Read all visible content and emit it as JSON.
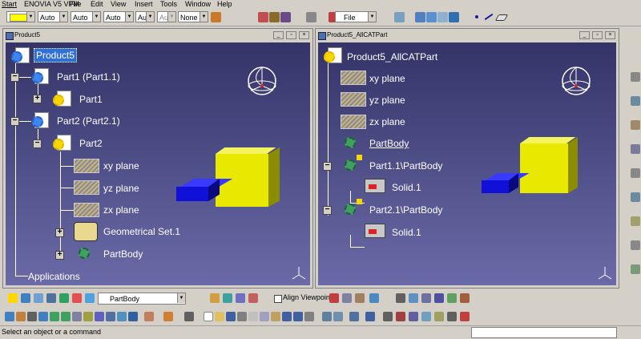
{
  "menu": [
    "Start",
    "ENOVIA V5 VPM",
    "File",
    "Edit",
    "View",
    "Insert",
    "Tools",
    "Window",
    "Help"
  ],
  "toolbar_top": {
    "color_combo": "",
    "combos": [
      "Auto",
      "Auto",
      "Auto",
      "Aut",
      "Aut",
      "None"
    ],
    "file_combo": "File"
  },
  "windows": [
    {
      "title": "Product5",
      "tree": {
        "root": "Product5",
        "items": [
          "Part1 (Part1.1)",
          "Part1",
          "Part2 (Part2.1)",
          "Part2",
          "xy plane",
          "yz plane",
          "zx plane",
          "Geometrical Set.1",
          "PartBody"
        ],
        "footer": "Applications"
      }
    },
    {
      "title": "Product5_AllCATPart",
      "tree": {
        "root": "Product5_AllCATPart",
        "items": [
          "xy plane",
          "yz plane",
          "zx plane",
          "PartBody",
          "Part1.1\\PartBody",
          "Solid.1",
          "Part2.1\\PartBody",
          "Solid.1"
        ]
      }
    }
  ],
  "toolbar_bottom": {
    "body_combo": "PartBody",
    "align_viewpoint": "Align Viewpoint"
  },
  "status": "Select an object or a command",
  "colors": {
    "viewport_top": "#343469",
    "viewport_bottom": "#6a6aa8",
    "selection": "#2f6fd6",
    "yellow_part": "#e8e800",
    "blue_part": "#1010d8"
  }
}
